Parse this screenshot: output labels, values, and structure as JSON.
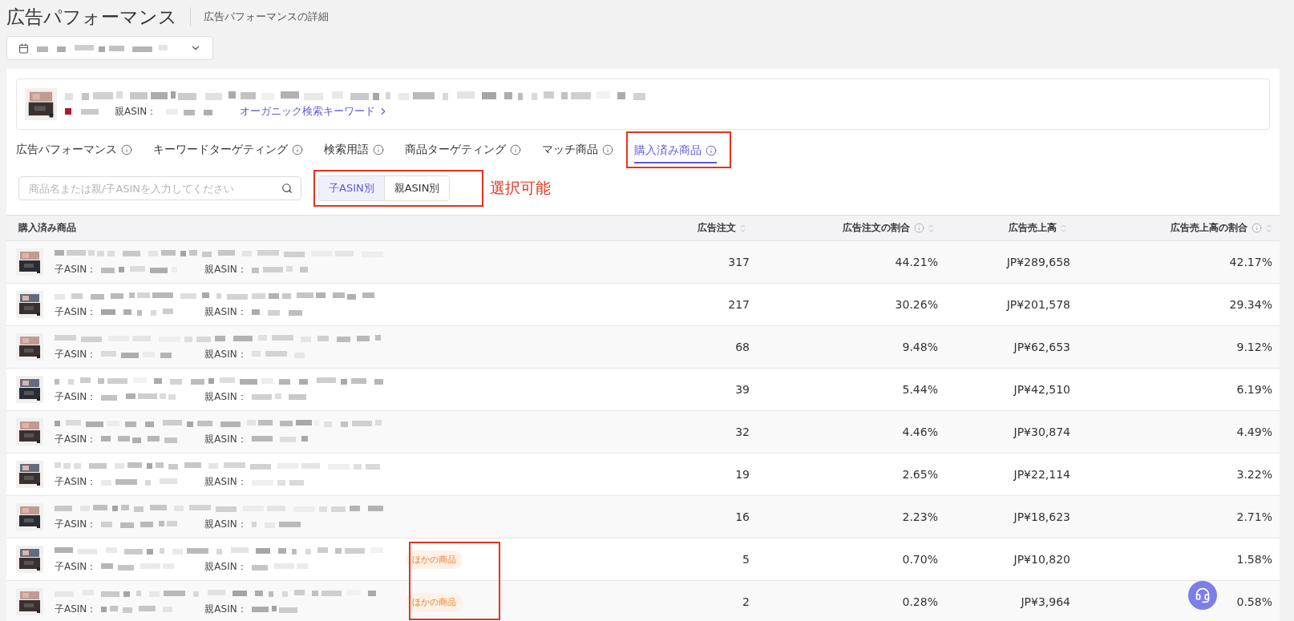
{
  "header": {
    "title": "広告パフォーマンス",
    "subtitle": "広告パフォーマンスの詳細"
  },
  "product": {
    "parent_asin_label": "親ASIN：",
    "link": "オーガニック検索キーワード"
  },
  "tabs": [
    {
      "label": "広告パフォーマンス",
      "selected": false,
      "annotated": false
    },
    {
      "label": "キーワードターゲティング",
      "selected": false,
      "annotated": false
    },
    {
      "label": "検索用語",
      "selected": false,
      "annotated": false
    },
    {
      "label": "商品ターゲティング",
      "selected": false,
      "annotated": false
    },
    {
      "label": "マッチ商品",
      "selected": false,
      "annotated": false
    },
    {
      "label": "購入済み商品",
      "selected": true,
      "annotated": true
    }
  ],
  "search": {
    "placeholder": "商品名または親/子ASINを入力してください"
  },
  "view_toggle": {
    "options": [
      {
        "label": "子ASIN別",
        "selected": true
      },
      {
        "label": "親ASIN別",
        "selected": false
      }
    ],
    "annotation": "選択可能"
  },
  "table": {
    "tag_annotated": true,
    "columns": [
      {
        "label": "購入済み商品",
        "info": false,
        "sortable": false
      },
      {
        "label": "広告注文",
        "info": false,
        "sortable": true
      },
      {
        "label": "広告注文の割合",
        "info": true,
        "sortable": true
      },
      {
        "label": "広告売上高",
        "info": false,
        "sortable": true
      },
      {
        "label": "広告売上高の割合",
        "info": true,
        "sortable": true
      }
    ],
    "rows": [
      {
        "child_asin_label": "子ASIN：",
        "parent_asin_label": "親ASIN：",
        "orders": "317",
        "orders_share": "44.21%",
        "sales": "JP¥289,658",
        "sales_share": "42.17%"
      },
      {
        "child_asin_label": "子ASIN：",
        "parent_asin_label": "親ASIN：",
        "orders": "217",
        "orders_share": "30.26%",
        "sales": "JP¥201,578",
        "sales_share": "29.34%"
      },
      {
        "child_asin_label": "子ASIN：",
        "parent_asin_label": "親ASIN：",
        "orders": "68",
        "orders_share": "9.48%",
        "sales": "JP¥62,653",
        "sales_share": "9.12%"
      },
      {
        "child_asin_label": "子ASIN：",
        "parent_asin_label": "親ASIN：",
        "orders": "39",
        "orders_share": "5.44%",
        "sales": "JP¥42,510",
        "sales_share": "6.19%"
      },
      {
        "child_asin_label": "子ASIN：",
        "parent_asin_label": "親ASIN：",
        "orders": "32",
        "orders_share": "4.46%",
        "sales": "JP¥30,874",
        "sales_share": "4.49%"
      },
      {
        "child_asin_label": "子ASIN：",
        "parent_asin_label": "親ASIN：",
        "orders": "19",
        "orders_share": "2.65%",
        "sales": "JP¥22,114",
        "sales_share": "3.22%"
      },
      {
        "child_asin_label": "子ASIN：",
        "parent_asin_label": "親ASIN：",
        "orders": "16",
        "orders_share": "2.23%",
        "sales": "JP¥18,623",
        "sales_share": "2.71%"
      },
      {
        "child_asin_label": "子ASIN：",
        "parent_asin_label": "親ASIN：",
        "tag": "ほかの商品",
        "orders": "5",
        "orders_share": "0.70%",
        "sales": "JP¥10,820",
        "sales_share": "1.58%"
      },
      {
        "child_asin_label": "子ASIN：",
        "parent_asin_label": "親ASIN：",
        "tag": "ほかの商品",
        "orders": "2",
        "orders_share": "0.28%",
        "sales": "JP¥3,964",
        "sales_share": "0.58%"
      }
    ]
  }
}
